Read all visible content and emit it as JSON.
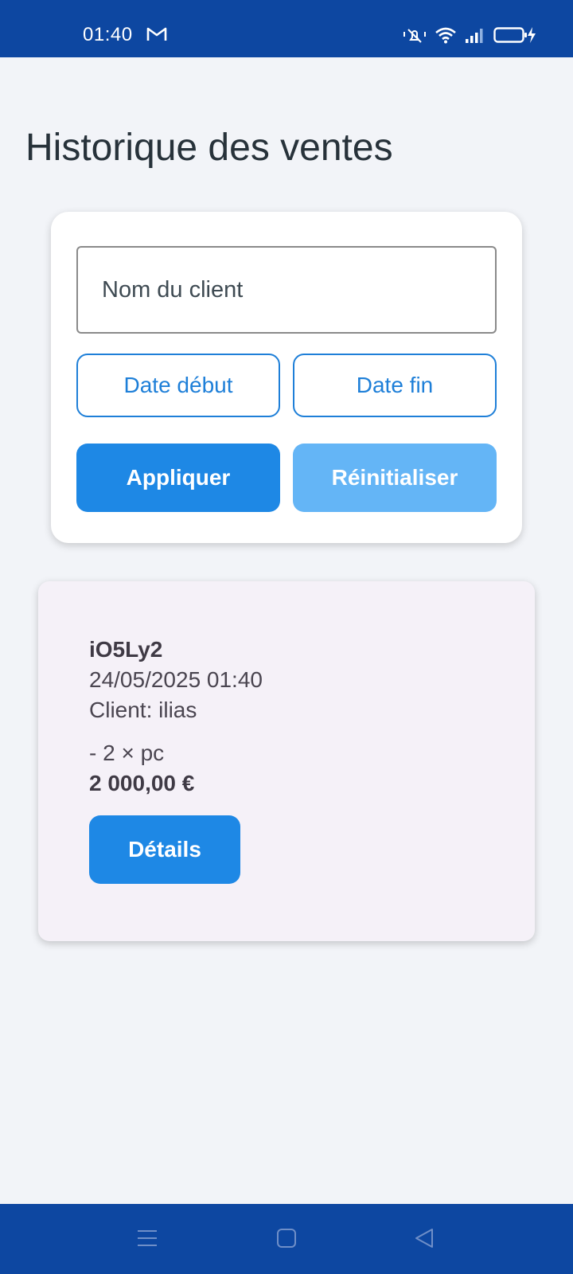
{
  "status_bar": {
    "time": "01:40",
    "icons": [
      "gmail-icon",
      "mute-icon",
      "wifi-icon",
      "signal-icon",
      "battery-charging-icon"
    ]
  },
  "page": {
    "title": "Historique des ventes"
  },
  "filters": {
    "client_placeholder": "Nom du client",
    "client_value": "",
    "date_start_label": "Date début",
    "date_end_label": "Date fin",
    "apply_label": "Appliquer",
    "reset_label": "Réinitialiser"
  },
  "sales": [
    {
      "id": "iO5Ly2",
      "datetime": "24/05/2025 01:40",
      "client": "Client: ilias",
      "item": "- 2 × pc",
      "total": "2 000,00 €",
      "details_label": "Détails"
    }
  ],
  "nav_bar": {
    "icons": [
      "menu-icon",
      "home-icon",
      "back-icon"
    ]
  },
  "colors": {
    "status_bar": "#0d47a1",
    "primary": "#1e88e5",
    "primary_light": "#64b5f6",
    "outline": "#1e7fd8",
    "background": "#f2f4f8",
    "sale_card": "#f5f1f8"
  }
}
